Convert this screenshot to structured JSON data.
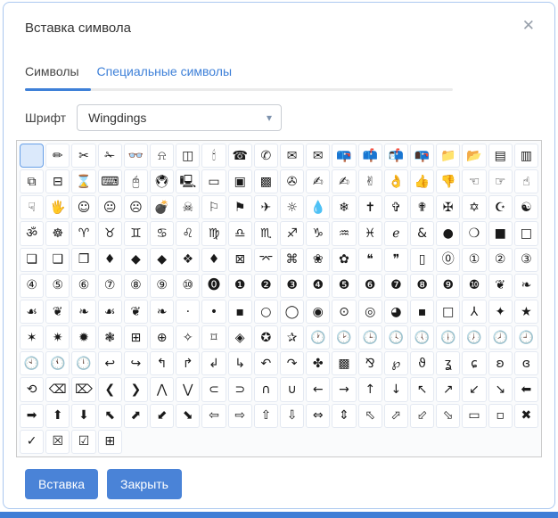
{
  "dialog": {
    "title": "Вставка символа",
    "close_icon": "✕"
  },
  "tabs": [
    {
      "label": "Символы",
      "active": true
    },
    {
      "label": "Специальные символы",
      "active": false
    }
  ],
  "font_row": {
    "label": "Шрифт",
    "selected_font": "Wingdings",
    "chevron_icon": "▾"
  },
  "grid": {
    "font_name": "Wingdings",
    "selected_index": 0,
    "columns": 20,
    "rows": [
      [
        "",
        "✏",
        "✂",
        "✁",
        "👓",
        "⍾",
        "◫",
        "🕯",
        "☎",
        "✆",
        "✉",
        "✉",
        "📪",
        "📫",
        "📬",
        "📭",
        "📁",
        "📂",
        "▤",
        "▥"
      ],
      [
        "⧉",
        "⊟",
        "⌛",
        "⌨",
        "🖰",
        "🖲",
        "🖳",
        "▭",
        "▣",
        "▩",
        "✇",
        "✍",
        "✍",
        "✌",
        "👌",
        "👍",
        "👎",
        "☜",
        "☞",
        "☝"
      ],
      [
        "☟",
        "🖐",
        "☺",
        "😐",
        "☹",
        "💣",
        "☠",
        "⚐",
        "⚑",
        "✈",
        "☼",
        "💧",
        "❄",
        "✝",
        "✞",
        "✟",
        "✠",
        "✡",
        "☪",
        "☯"
      ],
      [
        "ॐ",
        "☸",
        "♈",
        "♉",
        "♊",
        "♋",
        "♌",
        "♍",
        "♎",
        "♏",
        "♐",
        "♑",
        "♒",
        "♓",
        "ℯ",
        "&",
        "●",
        "❍",
        "■",
        "□"
      ],
      [
        "❏",
        "❑",
        "❒",
        "♦",
        "◆",
        "◆",
        "❖",
        "♦",
        "⊠",
        "⌤",
        "⌘",
        "❀",
        "✿",
        "❝",
        "❞",
        "▯",
        "⓪",
        "①",
        "②",
        "③"
      ],
      [
        "④",
        "⑤",
        "⑥",
        "⑦",
        "⑧",
        "⑨",
        "⑩",
        "⓿",
        "❶",
        "❷",
        "❸",
        "❹",
        "❺",
        "❻",
        "❼",
        "❽",
        "❾",
        "❿",
        "❦",
        "❧"
      ],
      [
        "☙",
        "❦",
        "❧",
        "☙",
        "❦",
        "❧",
        "·",
        "•",
        "▪",
        "○",
        "◯",
        "◉",
        "⊙",
        "◎",
        "◕",
        "▪",
        "□",
        "⅄",
        "✦",
        "★"
      ],
      [
        "✶",
        "✷",
        "✹",
        "❃",
        "⊞",
        "⊕",
        "✧",
        "⌑",
        "◈",
        "✪",
        "✰",
        "🕐",
        "🕑",
        "🕒",
        "🕓",
        "🕔",
        "🕕",
        "🕖",
        "🕗",
        "🕘"
      ],
      [
        "🕙",
        "🕚",
        "🕛",
        "↩",
        "↪",
        "↰",
        "↱",
        "↲",
        "↳",
        "↶",
        "↷",
        "✤",
        "▩",
        "⅋",
        "℘",
        "ϑ",
        "ʓ",
        "ɕ",
        "ʚ",
        "ɞ"
      ],
      [
        "⟲",
        "⌫",
        "⌦",
        "❮",
        "❯",
        "⋀",
        "⋁",
        "⊂",
        "⊃",
        "∩",
        "∪",
        "←",
        "→",
        "↑",
        "↓",
        "↖",
        "↗",
        "↙",
        "↘",
        "⬅"
      ],
      [
        "➡",
        "⬆",
        "⬇",
        "⬉",
        "⬈",
        "⬋",
        "⬊",
        "⇦",
        "⇨",
        "⇧",
        "⇩",
        "⇔",
        "⇕",
        "⬁",
        "⬀",
        "⬃",
        "⬂",
        "▭",
        "▫",
        "✖"
      ],
      [
        "✓",
        "☒",
        "☑",
        "⊞"
      ]
    ]
  },
  "buttons": {
    "insert_label": "Вставка",
    "close_label": "Закрыть"
  },
  "colors": {
    "accent_blue": "#4a83d7",
    "tab_link_blue": "#3e80d8",
    "dialog_border": "#abc8f0",
    "selected_cell_bg": "#dbe9fb",
    "selected_cell_border": "#68a0e8",
    "bottom_strip": "#3f7ed6"
  }
}
